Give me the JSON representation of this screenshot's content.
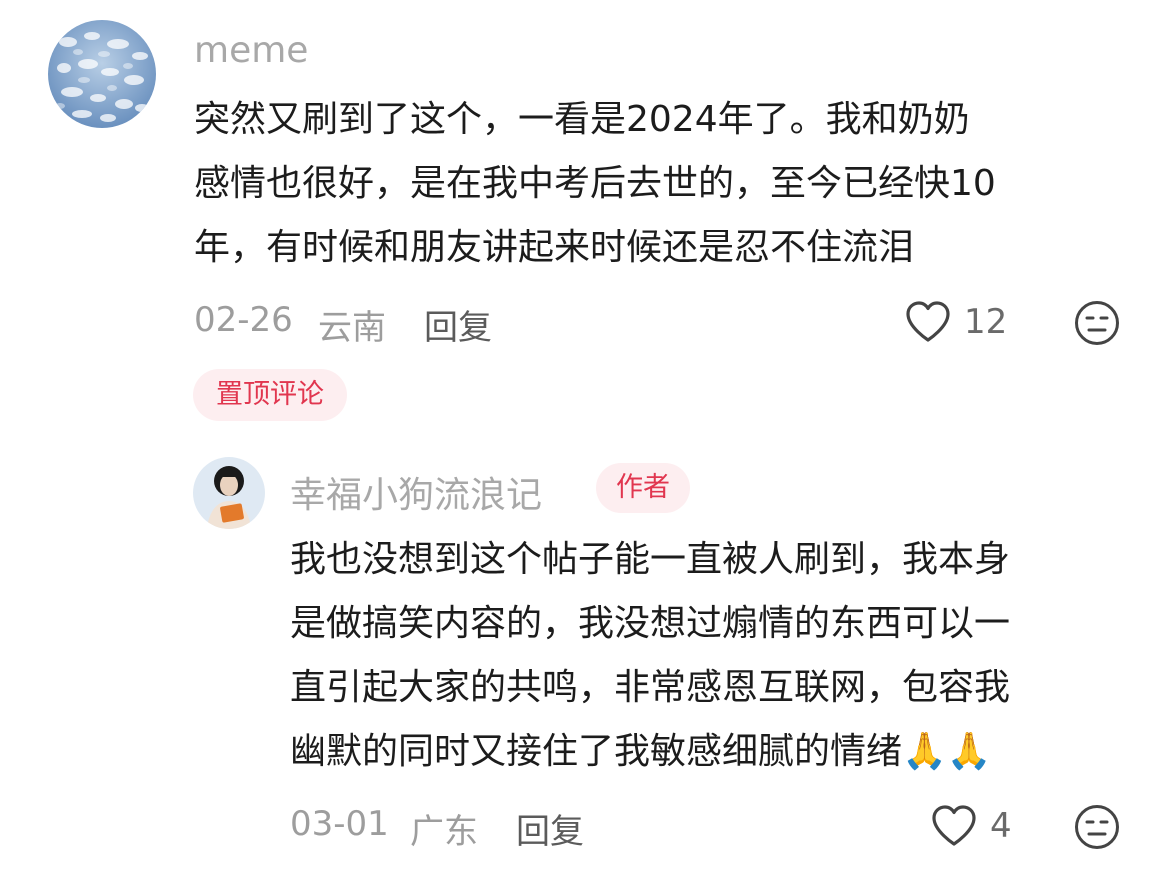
{
  "comments": [
    {
      "username": "meme",
      "text_lines": [
        "突然又刷到了这个，一看是2024年了。我和奶奶",
        "感情也很好，是在我中考后去世的，至今已经快10",
        "年，有时候和朋友讲起来时候还是忍不住流泪"
      ],
      "date": "02-26",
      "location": "云南",
      "reply_label": "回复",
      "likes": "12",
      "pinned_label": "置顶评论"
    }
  ],
  "reply": {
    "username": "幸福小狗流浪记",
    "author_badge": "作者",
    "text_lines": [
      "我也没想到这个帖子能一直被人刷到，我本身",
      "是做搞笑内容的，我没想过煽情的东西可以一",
      "直引起大家的共鸣，非常感恩互联网，包容我",
      "幽默的同时又接住了我敏感细腻的情绪🙏🙏"
    ],
    "date": "03-01",
    "location": "广东",
    "reply_label": "回复",
    "likes": "4"
  },
  "icons": {
    "like": "heart-outline-icon",
    "reaction": "meh-face-icon"
  },
  "colors": {
    "badge_bg": "#fdeef0",
    "badge_text": "#e1364f",
    "text": "#1c1c1c",
    "muted": "#a8a8a8"
  }
}
